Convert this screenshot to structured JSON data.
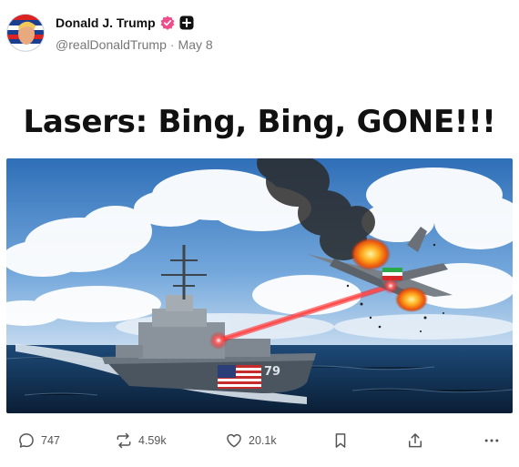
{
  "author": {
    "name": "Donald J. Trump",
    "handle": "@realDonaldTrump",
    "date": "May 8"
  },
  "post": {
    "headline": "Lasers: Bing, Bing, GONE!!!",
    "ship_hull_number": "79"
  },
  "actions": {
    "replies": "747",
    "reposts": "4.59k",
    "likes": "20.1k"
  },
  "colors": {
    "verified_badge": "#ee4c8a",
    "laser": "#ff1a1a",
    "sky": "#4f86c6",
    "sea": "#0f2a47"
  },
  "icons": [
    "verified-badge-icon",
    "plus-icon",
    "reply-icon",
    "repost-icon",
    "like-icon",
    "bookmark-icon",
    "share-icon",
    "more-icon"
  ]
}
